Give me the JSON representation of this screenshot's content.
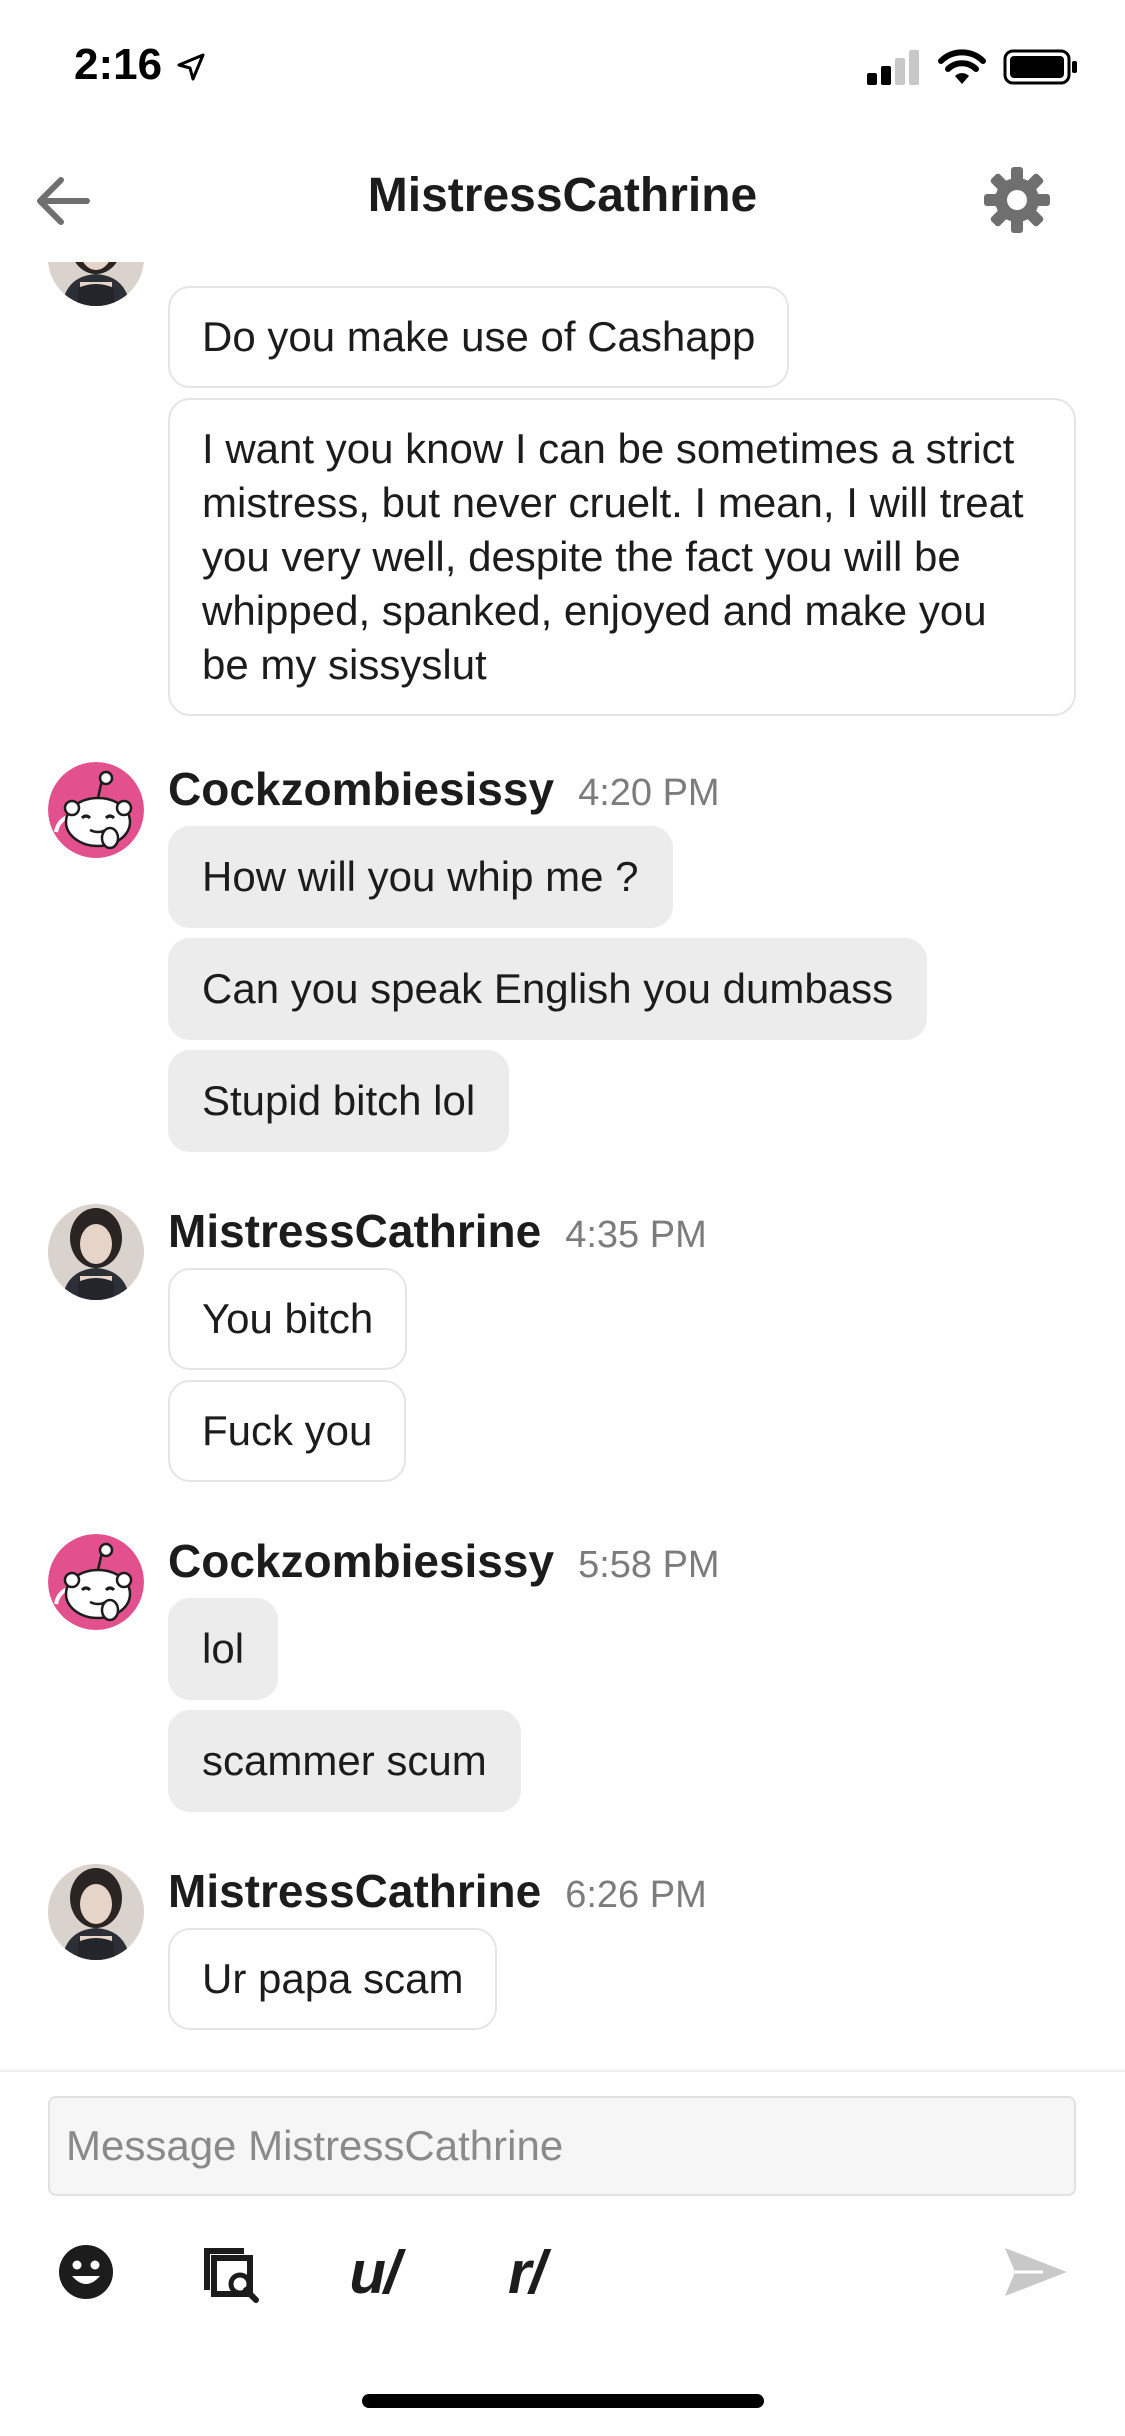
{
  "status_bar": {
    "time": "2:16",
    "location_icon": "location-arrow-icon",
    "signal_icon": "cellular-signal-icon",
    "wifi_icon": "wifi-icon",
    "battery_icon": "battery-icon"
  },
  "header": {
    "title": "MistressCathrine",
    "back_icon": "back-arrow-icon",
    "settings_icon": "gear-icon"
  },
  "messages": {
    "group0": {
      "author": "",
      "bubbles": [
        "Do you make use of Cashapp",
        "I want you know I can be sometimes a strict mistress, but never cruelt. I mean, I will treat you very well, despite the fact you will be whipped, spanked, enjoyed and make you be my sissyslut"
      ]
    },
    "group1": {
      "author": "Cockzombiesissy",
      "time": "4:20 PM",
      "bubbles": [
        "How will you whip me ?",
        "Can you speak English you dumbass",
        "Stupid bitch lol"
      ]
    },
    "group2": {
      "author": "MistressCathrine",
      "time": "4:35 PM",
      "bubbles": [
        "You bitch",
        "Fuck you"
      ]
    },
    "group3": {
      "author": "Cockzombiesissy",
      "time": "5:58 PM",
      "bubbles": [
        "lol",
        "scammer scum"
      ]
    },
    "group4": {
      "author": "MistressCathrine",
      "time": "6:26 PM",
      "bubbles": [
        "Ur papa scam"
      ]
    }
  },
  "composer": {
    "placeholder": "Message MistressCathrine",
    "value": "",
    "emoji_icon": "emoji-icon",
    "gallery_icon": "image-search-icon",
    "user_mention_label": "u/",
    "subreddit_mention_label": "r/",
    "send_icon": "send-icon"
  },
  "colors": {
    "other_bubble_bg": "#ececed",
    "own_bubble_border": "#e5e5e5",
    "timestamp": "#7c7c7c",
    "snoo_avatar_bg": "#e2508e",
    "icon_gray": "#6f6f6f",
    "send_disabled": "#c8c8c8"
  }
}
